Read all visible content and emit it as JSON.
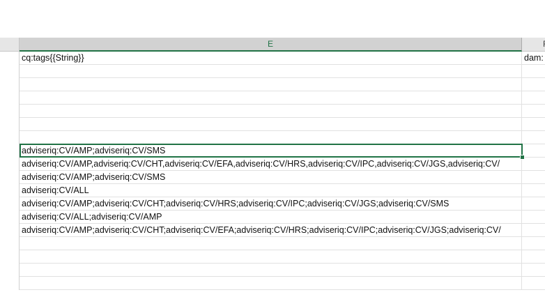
{
  "columns": {
    "selected_label": "E",
    "next_label": "F"
  },
  "cells": {
    "e1": "cq:tags{{String}}",
    "f1": "dam:",
    "e8": "adviseriq:CV/AMP;adviseriq:CV/SMS",
    "e9": "adviseriq:CV/AMP,adviseriq:CV/CHT,adviseriq:CV/EFA,adviseriq:CV/HRS,adviseriq:CV/IPC,adviseriq:CV/JGS,adviseriq:CV/",
    "e10": "adviseriq:CV/AMP;adviseriq:CV/SMS",
    "e11": "adviseriq:CV/ALL",
    "e12": "adviseriq:CV/AMP;adviseriq:CV/CHT;adviseriq:CV/HRS;adviseriq:CV/IPC;adviseriq:CV/JGS;adviseriq:CV/SMS",
    "e13": "adviseriq:CV/ALL;adviseriq:CV/AMP",
    "e14": "adviseriq:CV/AMP;adviseriq:CV/CHT;adviseriq:CV/EFA;adviseriq:CV/HRS;adviseriq:CV/IPC;adviseriq:CV/JGS;adviseriq:CV/"
  },
  "colors": {
    "accent": "#217346",
    "header_selected_bg": "#d2d2d2",
    "gridline": "#e1e1e1"
  }
}
